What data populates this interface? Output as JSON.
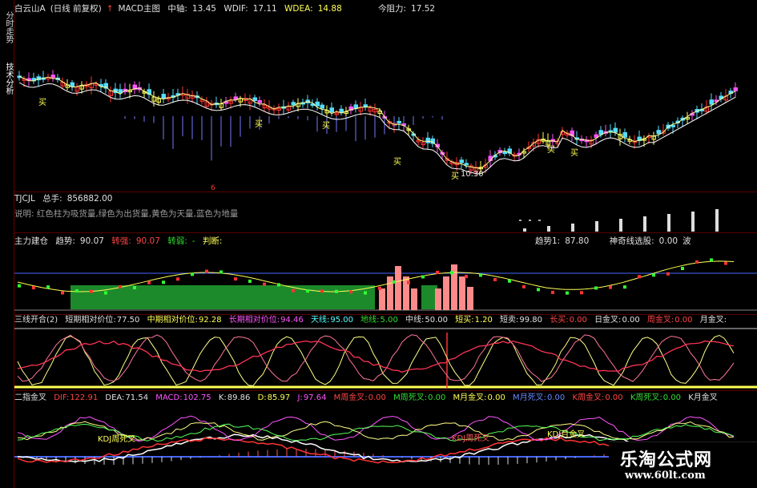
{
  "sidebar": {
    "tabs": [
      "分时走势",
      "技术分析"
    ]
  },
  "main_header": {
    "stock": "白云山A",
    "mode": "(日线 前复权)",
    "indicator": "MACD主图",
    "axis_label": "中轴:",
    "axis_value": "13.45",
    "wdif_label": "WDIF:",
    "wdif_value": "17.11",
    "wdea_label": "WDEA:",
    "wdea_value": "14.88",
    "resist_label": "今阻力:",
    "resist_value": "17.52"
  },
  "main_annotations": {
    "buy": "买",
    "price_low": "10.30"
  },
  "tjcjl": {
    "name": "TJCJL",
    "total_label": "总手:",
    "total_value": "856882.00",
    "desc": "说明: 红色柱为吸货量,绿色为出货量,黄色为天量,蓝色为地量"
  },
  "zhuli": {
    "name": "主力建仓",
    "trend_label": "趋势:",
    "trend_value": "90.07",
    "strong_label": "转强:",
    "strong_value": "90.07",
    "weak_label": "转弱:",
    "weak_value": "-",
    "judge_label": "判断:",
    "trend1_label": "趋势1:",
    "trend1_value": "87.80",
    "magic_label": "神奇线选股:",
    "magic_value": "0.00",
    "wave_label": "波"
  },
  "sanxian": {
    "name": "三线开合(2)",
    "short_label": "短期相对价位:",
    "short_value": "77.50",
    "mid_label": "中期相对价位:",
    "mid_value": "92.28",
    "long_label": "长期相对价位:",
    "long_value": "94.46",
    "sky_label": "天线:",
    "sky_value": "95.00",
    "ground_label": "地线:",
    "ground_value": "5.00",
    "midline_label": "中线:",
    "midline_value": "50.00",
    "sbuy_label": "短买:",
    "sbuy_value": "1.20",
    "ssell_label": "短卖:",
    "ssell_value": "99.80",
    "lbuy_label": "长买:",
    "lbuy_value": "0.00",
    "dgold_label": "日金叉:",
    "dgold_value": "0.00",
    "wgold_label": "周金叉:",
    "wgold_value": "0.00",
    "mgold_label": "月金叉:"
  },
  "erzhi": {
    "name": "二指金叉",
    "dif_label": "DIF:",
    "dif_value": "122.91",
    "dea_label": "DEA:",
    "dea_value": "71.54",
    "macd_label": "MACD:",
    "macd_value": "102.75",
    "k_label": "K:",
    "k_value": "89.86",
    "d_label": "D:",
    "d_value": "85.97",
    "j_label": "J:",
    "j_value": "97.64",
    "mwg_label": "M周金叉:",
    "mwg_value": "0.00",
    "mwd_label": "M周死叉:",
    "mwd_value": "0.00",
    "mmg_label": "M月金叉:",
    "mmg_value": "0.00",
    "mmd_label": "M月死叉:",
    "mmd_value": "0.00",
    "kwg_label": "K周金叉:",
    "kwg_value": "0.00",
    "kwd_label": "K周死叉:",
    "kwd_value": "0.00",
    "kmg_label": "K月金叉"
  },
  "erzhi_annotations": {
    "kdj_weekly": "KDJ周死叉",
    "kdj_monthly": "KDJ月金叉"
  },
  "watermark": {
    "title": "乐淘公式网",
    "url": "www.60lt.com"
  }
}
